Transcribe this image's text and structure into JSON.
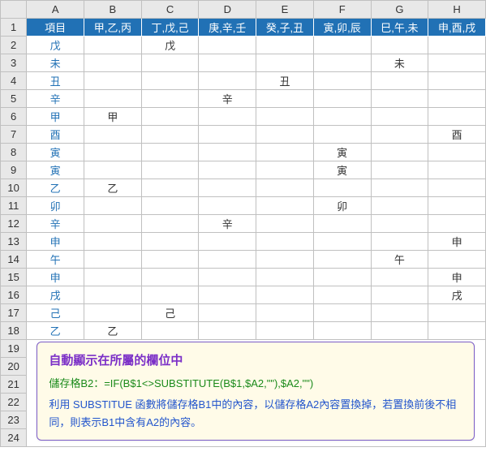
{
  "columns": [
    "A",
    "B",
    "C",
    "D",
    "E",
    "F",
    "G",
    "H"
  ],
  "header_row": [
    "項目",
    "甲,乙,丙",
    "丁,戊,己",
    "庚,辛,壬",
    "癸,子,丑",
    "寅,卯,辰",
    "巳,午,未",
    "申,酉,戌"
  ],
  "rows": [
    {
      "n": 2,
      "a": "戊",
      "cells": [
        "",
        "戊",
        "",
        "",
        "",
        "",
        ""
      ]
    },
    {
      "n": 3,
      "a": "未",
      "cells": [
        "",
        "",
        "",
        "",
        "",
        "未",
        ""
      ]
    },
    {
      "n": 4,
      "a": "丑",
      "cells": [
        "",
        "",
        "",
        "丑",
        "",
        "",
        ""
      ]
    },
    {
      "n": 5,
      "a": "辛",
      "cells": [
        "",
        "",
        "辛",
        "",
        "",
        "",
        ""
      ]
    },
    {
      "n": 6,
      "a": "甲",
      "cells": [
        "甲",
        "",
        "",
        "",
        "",
        "",
        ""
      ]
    },
    {
      "n": 7,
      "a": "酉",
      "cells": [
        "",
        "",
        "",
        "",
        "",
        "",
        "酉"
      ]
    },
    {
      "n": 8,
      "a": "寅",
      "cells": [
        "",
        "",
        "",
        "",
        "寅",
        "",
        ""
      ]
    },
    {
      "n": 9,
      "a": "寅",
      "cells": [
        "",
        "",
        "",
        "",
        "寅",
        "",
        ""
      ]
    },
    {
      "n": 10,
      "a": "乙",
      "cells": [
        "乙",
        "",
        "",
        "",
        "",
        "",
        ""
      ]
    },
    {
      "n": 11,
      "a": "卯",
      "cells": [
        "",
        "",
        "",
        "",
        "卯",
        "",
        ""
      ]
    },
    {
      "n": 12,
      "a": "辛",
      "cells": [
        "",
        "",
        "辛",
        "",
        "",
        "",
        ""
      ]
    },
    {
      "n": 13,
      "a": "申",
      "cells": [
        "",
        "",
        "",
        "",
        "",
        "",
        "申"
      ]
    },
    {
      "n": 14,
      "a": "午",
      "cells": [
        "",
        "",
        "",
        "",
        "",
        "午",
        ""
      ]
    },
    {
      "n": 15,
      "a": "申",
      "cells": [
        "",
        "",
        "",
        "",
        "",
        "",
        "申"
      ]
    },
    {
      "n": 16,
      "a": "戌",
      "cells": [
        "",
        "",
        "",
        "",
        "",
        "",
        "戌"
      ]
    },
    {
      "n": 17,
      "a": "己",
      "cells": [
        "",
        "己",
        "",
        "",
        "",
        "",
        ""
      ]
    },
    {
      "n": 18,
      "a": "乙",
      "cells": [
        "乙",
        "",
        "",
        "",
        "",
        "",
        ""
      ]
    }
  ],
  "extra_rows": [
    19,
    20,
    21,
    22,
    23,
    24
  ],
  "note": {
    "title": "自動顯示在所屬的欄位中",
    "formula": "儲存格B2：=IF(B$1<>SUBSTITUTE(B$1,$A2,\"\"),$A2,\"\")",
    "desc": "利用 SUBSTITUE 函數將儲存格B1中的內容，以儲存格A2內容置換掉，若置換前後不相同，則表示B1中含有A2的內容。"
  }
}
